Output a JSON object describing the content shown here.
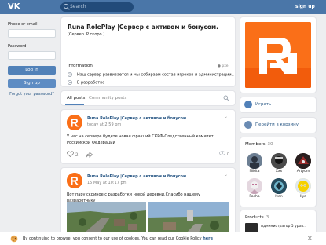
{
  "topbar": {
    "logo": "VK",
    "search_placeholder": "Search",
    "signup_label": "sign up"
  },
  "login": {
    "phone_label": "Phone or email",
    "password_label": "Password",
    "login_button": "Log in",
    "signup_button": "Sign up",
    "forgot_label": "Forgot your password?"
  },
  "group": {
    "title": "Runa RolePlay |Сервер с активом и бонусом.",
    "subtitle": "[Сервер IP скоро ]",
    "information_label": "Information",
    "information_extra": "● pxe",
    "info_rows": [
      {
        "icon": "info-icon",
        "text": "Наш сервер развивается и мы собираем состав игроков и администрации.."
      },
      {
        "icon": "location-icon",
        "text": "В разработке"
      }
    ]
  },
  "sidebar": {
    "action_join": "Играть",
    "action_store": "Перейти в корзину",
    "members_label": "Members",
    "members_count": "30",
    "members": [
      {
        "name": "Nikita"
      },
      {
        "name": "Xxx"
      },
      {
        "name": "Artyom"
      },
      {
        "name": "Pasha"
      },
      {
        "name": "Ivan"
      },
      {
        "name": "Ilya"
      }
    ],
    "products_label": "Products",
    "products_count": "3",
    "product_text": "Администратор 5 уров..."
  },
  "wall": {
    "tab_all": "All posts",
    "tab_community": "Community posts"
  },
  "posts": [
    {
      "author": "Runa RolePlay |Сервер с активом и бонусом.",
      "date": "today at 2:59 pm",
      "text": "У нас на сервере будете новая фракций СКРФ-Следственный комитет Российской Федерации",
      "likes": "2",
      "views": "0"
    },
    {
      "author": "Runa RolePlay |Сервер с активом и бонусом.",
      "date": "15 May at 10:17 pm",
      "text": "Вот пару скриное с разработки новой деревни.Спасибо нашему разработчику"
    }
  ],
  "cookie": {
    "text": "By continuing to browse, you consent to our use of cookies. You can read our Cookie Policy",
    "link": "here",
    "close": "✕"
  },
  "colors": {
    "accent": "#4a76a8",
    "brand_orange": "#fa6f18",
    "link": "#2a5885"
  }
}
